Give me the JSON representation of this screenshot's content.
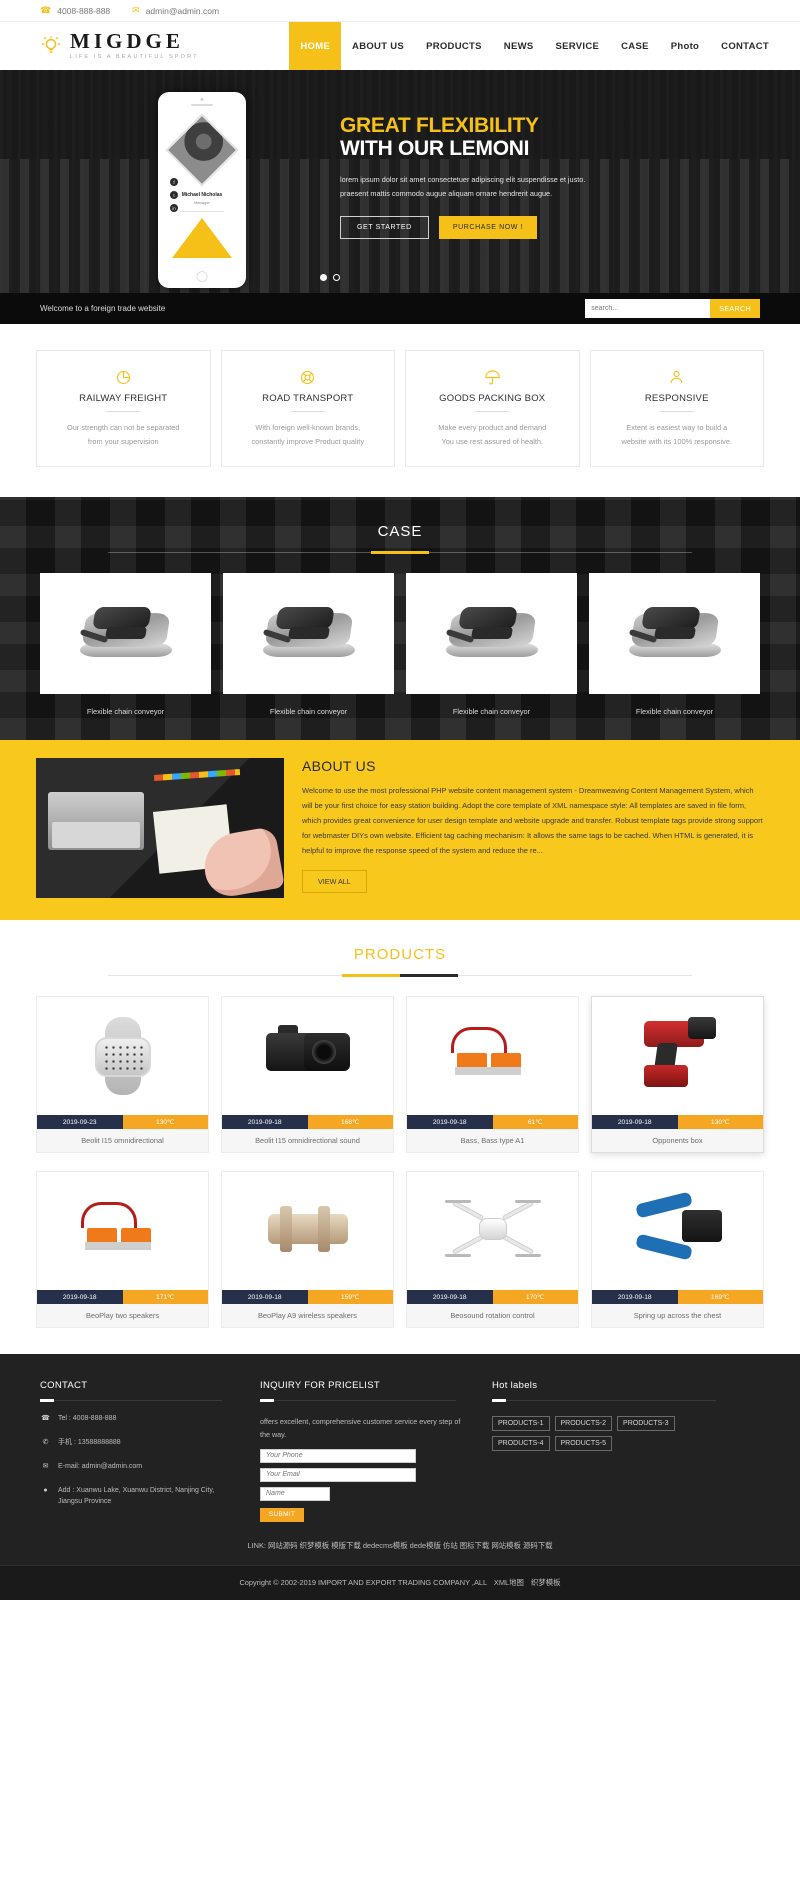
{
  "topbar": {
    "phone": "4008-888-888",
    "email": "admin@admin.com",
    "phone_icon": "phone-icon",
    "mail_icon": "mail-icon"
  },
  "brand": {
    "name": "MIGDGE",
    "tagline": "LIFE IS A BEAUTIFUL SPORT",
    "logo_icon": "lightbulb-icon",
    "accent": "#f5c119"
  },
  "nav": {
    "items": [
      {
        "label": "HOME",
        "active": true
      },
      {
        "label": "ABOUT US",
        "active": false
      },
      {
        "label": "PRODUCTS",
        "active": false
      },
      {
        "label": "NEWS",
        "active": false
      },
      {
        "label": "SERVICE",
        "active": false
      },
      {
        "label": "CASE",
        "active": false
      },
      {
        "label": "Photo",
        "active": false
      },
      {
        "label": "CONTACT",
        "active": false
      }
    ]
  },
  "hero": {
    "title_line1": "GREAT FLEXIBILITY",
    "title_line2": "WITH OUR LEMONI",
    "para_line1": "lorem ipsum dolor sit amet consectetuer adipiscing elit suspendisse et justo.",
    "para_line2": "praesent mattis commodo augue aliquam ornare hendrerit augue.",
    "btn_primary": "GET STARTED",
    "btn_secondary": "PURCHASE NOW !",
    "phone_person_name": "Michael Nicholas",
    "phone_person_role": "Manager",
    "slide_count": 2,
    "active_slide": 1
  },
  "welcome": {
    "message": "Welcome to a foreign trade website",
    "search_placeholder": "search...",
    "search_value": "",
    "search_button": "SEARCH"
  },
  "features": [
    {
      "icon": "pie-chart-icon",
      "title": "RAILWAY FREIGHT",
      "line1": "Our strength can not be separated",
      "line2": "from your supervision"
    },
    {
      "icon": "lifebuoy-icon",
      "title": "ROAD TRANSPORT",
      "line1": "With foreign well-known brands,",
      "line2": "constantly improve Product quality"
    },
    {
      "icon": "umbrella-icon",
      "title": "GOODS PACKING BOX",
      "line1": "Make every product and demand",
      "line2": "You use rest assured of health."
    },
    {
      "icon": "user-icon",
      "title": "RESPONSIVE",
      "line1": "Extent is easiest way to build a",
      "line2": "website with its 100% responsive."
    }
  ],
  "case": {
    "title": "CASE",
    "items": [
      {
        "caption": "Flexible chain conveyor"
      },
      {
        "caption": "Flexible chain conveyor"
      },
      {
        "caption": "Flexible chain conveyor"
      },
      {
        "caption": "Flexible chain conveyor"
      }
    ]
  },
  "about": {
    "title": "ABOUT US",
    "body": "Welcome to use the most professional PHP website content management system - Dreamweaving Content Management System, which will be your first choice for easy station building. Adopt the core template of XML namespace style: All templates are saved in file form, which provides great convenience for user design template and website upgrade and transfer. Robust template tags provide strong support for webmaster DIYs own website. Efficient tag caching mechanism: It allows the same tags to be cached. When HTML is generated, it is helpful to improve the response speed of the system and reduce the re...",
    "button": "VIEW ALL"
  },
  "products": {
    "title": "PRODUCTS",
    "items": [
      {
        "date": "2019-09-23",
        "temp": "130℃",
        "name": "Beolit I15 omnidirectional",
        "art": "art-watch",
        "highlight": false
      },
      {
        "date": "2019-09-18",
        "temp": "168℃",
        "name": "Beolit I15 omnidirectional sound",
        "art": "art-cam",
        "highlight": false
      },
      {
        "date": "2019-09-18",
        "temp": "61℃",
        "name": "Bass, Bass type A1",
        "art": "art-conn",
        "highlight": false
      },
      {
        "date": "2019-09-18",
        "temp": "130℃",
        "name": "Opponents box",
        "art": "art-tool",
        "highlight": true
      },
      {
        "date": "2019-09-18",
        "temp": "171℃",
        "name": "BeoPlay two speakers",
        "art": "art-conn",
        "highlight": false
      },
      {
        "date": "2019-09-18",
        "temp": "159℃",
        "name": "BeoPlay A9 wireless speakers",
        "art": "art-valve",
        "highlight": false
      },
      {
        "date": "2019-09-18",
        "temp": "170℃",
        "name": "Beosound rotation control",
        "art": "art-drone",
        "highlight": false
      },
      {
        "date": "2019-09-18",
        "temp": "169℃",
        "name": "Spring up across the chest",
        "art": "art-crimp",
        "highlight": false
      }
    ]
  },
  "footer": {
    "contact": {
      "title": "CONTACT",
      "rows": [
        {
          "icon": "phone-icon",
          "text": "Tel : 4008-888-888"
        },
        {
          "icon": "whatsapp-icon",
          "text": "手机 : 13588888888"
        },
        {
          "icon": "mail-icon",
          "text": "E-mail: admin@admin.com"
        },
        {
          "icon": "location-pin-icon",
          "text": "Add : Xuanwu Lake, Xuanwu District, Nanjing City, Jiangsu Province"
        }
      ]
    },
    "inquiry": {
      "title": "INQUIRY FOR PRICELIST",
      "blurb": "offers excellent, comprehensive customer service every step of the way.",
      "phone_placeholder": "Your Phone",
      "email_placeholder": "Your Email",
      "name_placeholder": "Name",
      "submit_label": "SUBMIT"
    },
    "hot_labels": {
      "title": "Hot labels",
      "tags": [
        "PRODUCTS-1",
        "PRODUCTS-2",
        "PRODUCTS-3",
        "PRODUCTS-4",
        "PRODUCTS-5"
      ]
    },
    "links_line": "LINK: 网站源码 织梦模板 模版下载 dedecms模板 dede模版 仿站 图标下载 网站模板 源码下载",
    "copyright": "Copyright © 2002-2019 IMPORT AND EXPORT TRADING COMPANY ,ALL",
    "copyright_link1": "XML地图",
    "copyright_link2": "织梦模板"
  }
}
